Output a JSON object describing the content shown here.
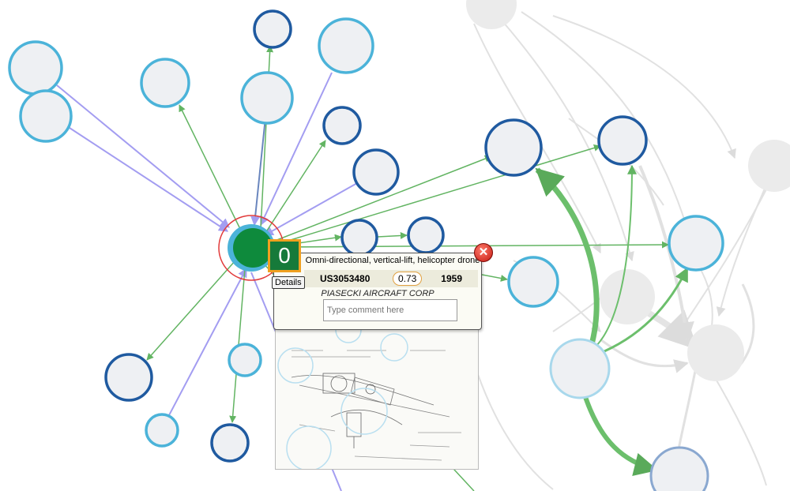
{
  "popup": {
    "rank": "0",
    "title": "Omni-directional, vertical-lift, helicopter drone",
    "patent_number": "US3053480",
    "score": "0.73",
    "year": "1959",
    "assignee": "PIASECKI AIRCRAFT CORP",
    "comment_placeholder": "Type comment here",
    "details_label": "Details",
    "close_icon": "close-x-icon"
  },
  "colors": {
    "focus_node": "#0e8a3c",
    "focus_ring": "#e23a3a",
    "dark_node_stroke": "#1f5aa0",
    "light_node_stroke": "#4bb3d9",
    "node_fill": "#eef0f3",
    "citing_edge": "#62b462",
    "cited_edge": "#9a93f0",
    "faded": "#d8d8d8"
  }
}
